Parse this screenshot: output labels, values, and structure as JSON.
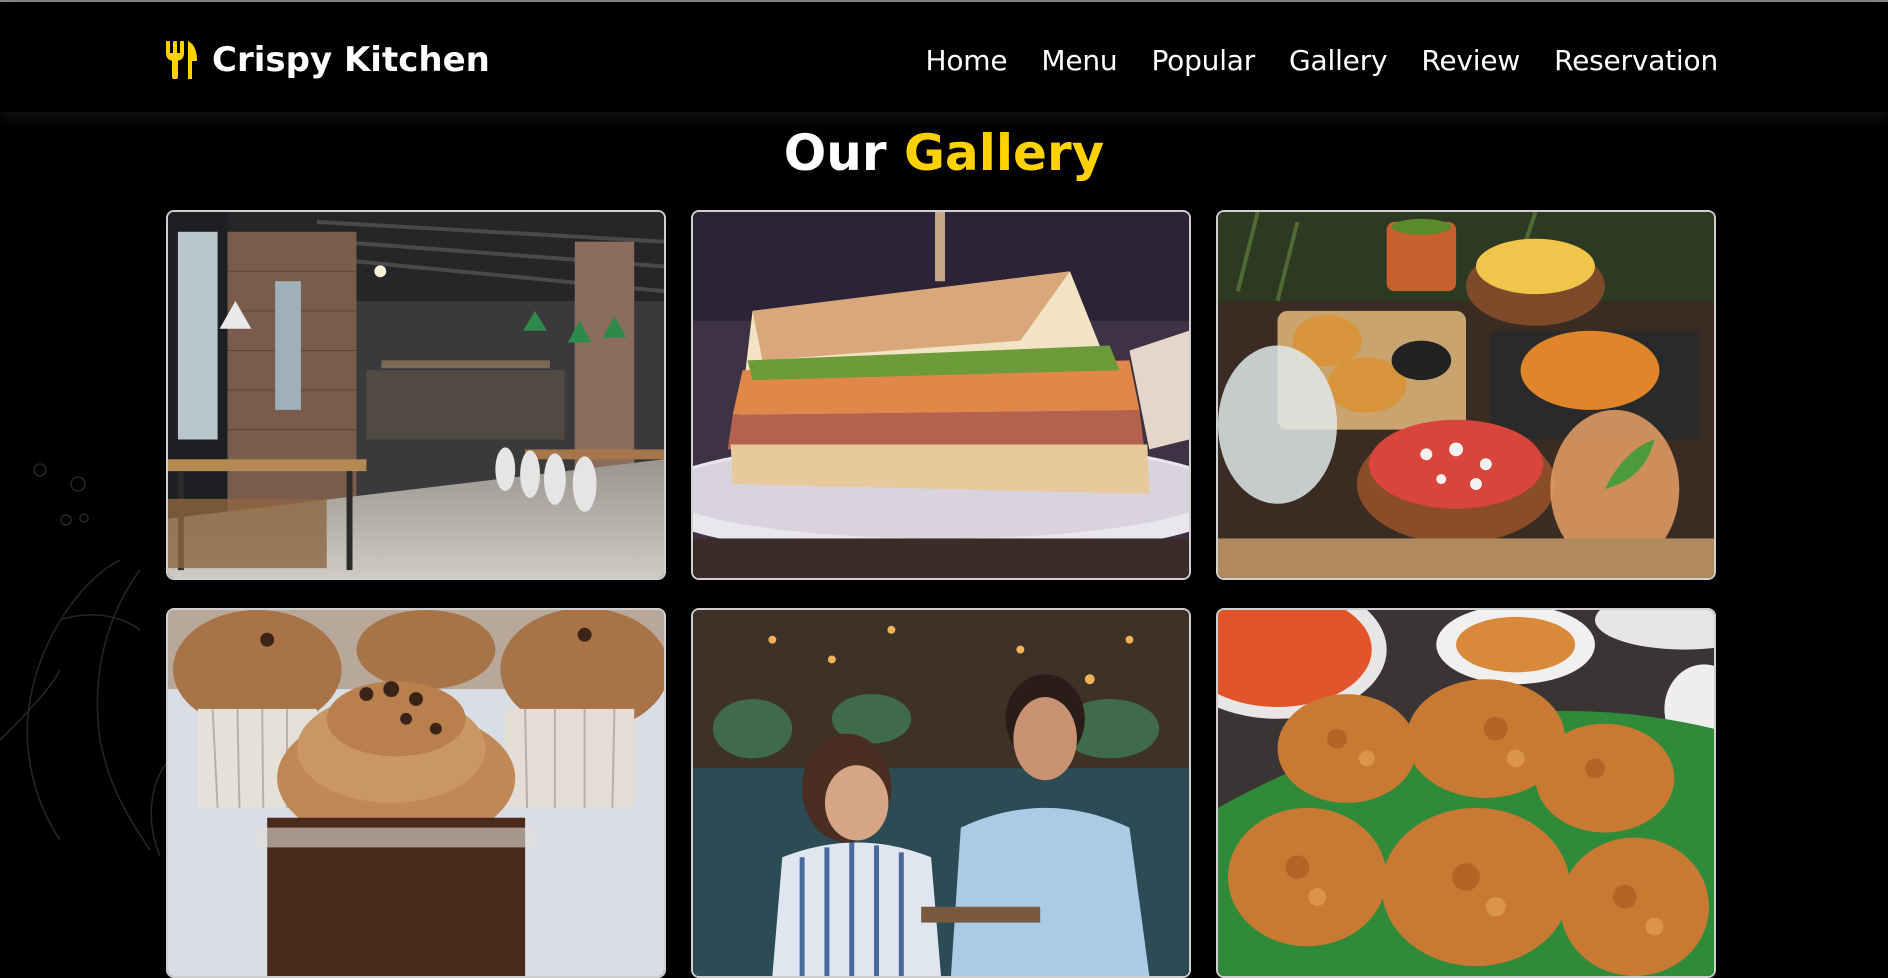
{
  "header": {
    "brand": "Crispy Kitchen",
    "nav": [
      "Home",
      "Menu",
      "Popular",
      "Gallery",
      "Review",
      "Reservation"
    ]
  },
  "gallery": {
    "title_main": "Our",
    "title_accent": "Gallery",
    "images": [
      {
        "name": "restaurant-interior-photo"
      },
      {
        "name": "sandwich-photo"
      },
      {
        "name": "food-spread-photo"
      },
      {
        "name": "chocolate-cupcakes-photo"
      },
      {
        "name": "couple-dining-photo"
      },
      {
        "name": "fried-chicken-photo"
      }
    ]
  },
  "colors": {
    "accent": "#ffd200",
    "background": "#000000",
    "text": "#ffffff"
  }
}
